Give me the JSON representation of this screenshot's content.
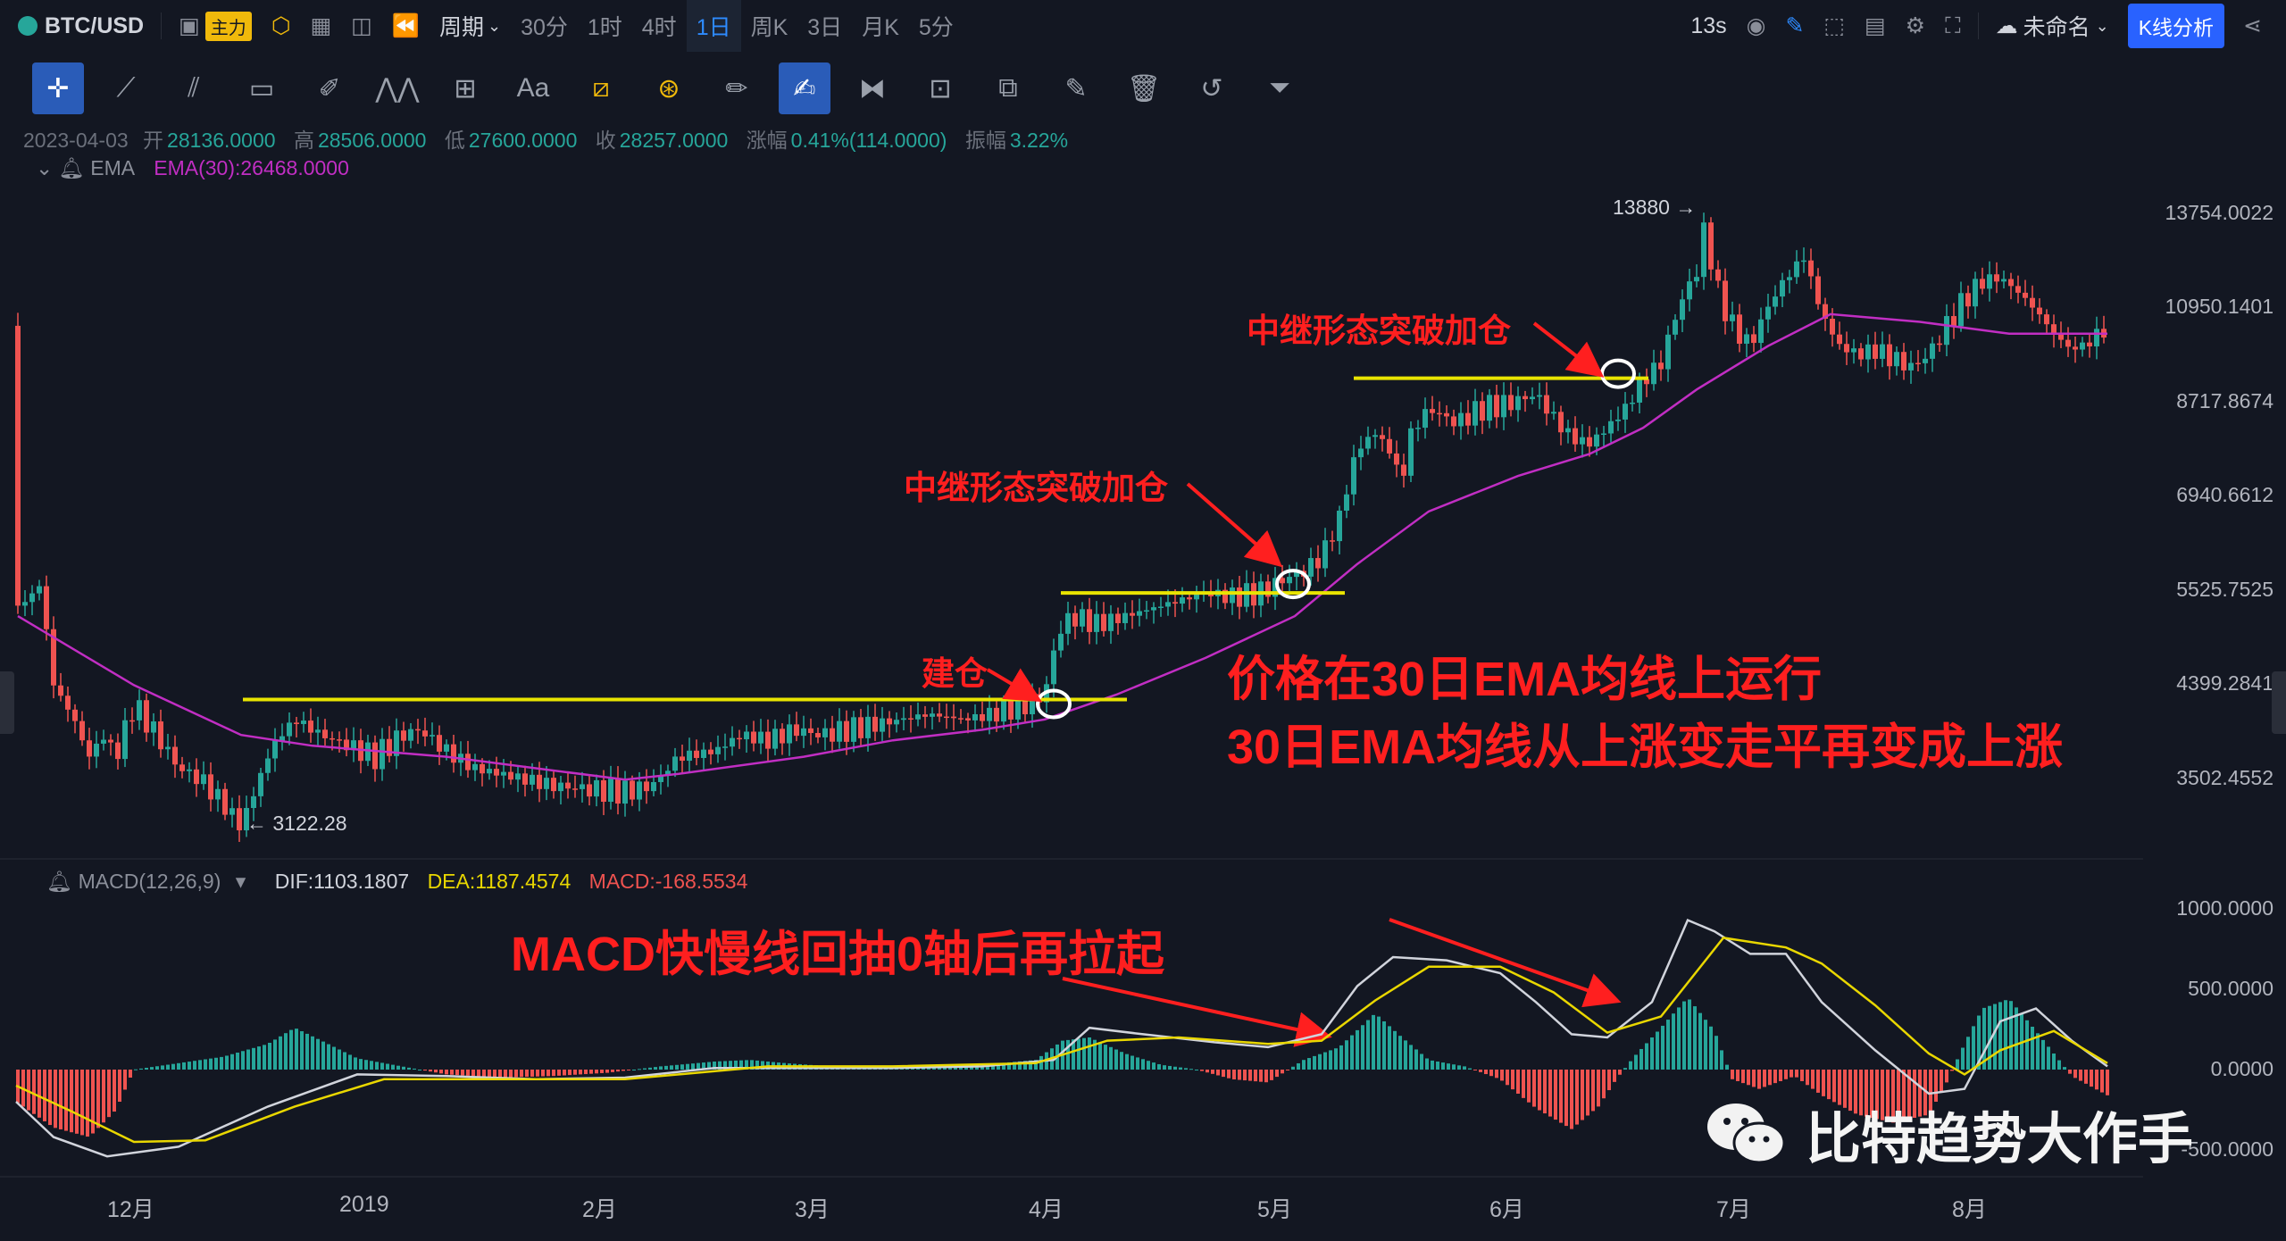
{
  "topbar": {
    "symbol": "BTC/USD",
    "main_badge": "主力",
    "period_label": "周期",
    "intervals": [
      "30分",
      "1时",
      "4时",
      "1日",
      "周K",
      "3日",
      "月K",
      "5分"
    ],
    "active_interval": "1日",
    "countdown": "13s",
    "layout_name": "未命名",
    "analysis_button": "K线分析"
  },
  "toolbar": {
    "text_tool": "Aa"
  },
  "legend": {
    "date": "2023-04-03",
    "open_label": "开",
    "open": "28136.0000",
    "high_label": "高",
    "high": "28506.0000",
    "low_label": "低",
    "low": "27600.0000",
    "close_label": "收",
    "close": "28257.0000",
    "change_label": "涨幅",
    "change": "0.41%(114.0000)",
    "amp_label": "振幅",
    "amp": "3.22%"
  },
  "ema_indicator": {
    "name": "EMA",
    "value_text": "EMA(30):26468.0000"
  },
  "macd_indicator": {
    "name": "MACD(12,26,9)",
    "dif": "DIF:1103.1807",
    "dea": "DEA:1187.4574",
    "macd": "MACD:-168.5534"
  },
  "price_axis": [
    "13754.0022",
    "10950.1401",
    "8717.8674",
    "6940.6612",
    "5525.7525",
    "4399.2841",
    "3502.4552"
  ],
  "macd_axis": [
    "1000.0000",
    "500.0000",
    "0.0000",
    "-500.0000"
  ],
  "time_axis": [
    "12月",
    "2019",
    "2月",
    "3月",
    "4月",
    "5月",
    "6月",
    "7月",
    "8月"
  ],
  "price_markers": {
    "high": "13880",
    "low": "3122.28"
  },
  "annotations": {
    "build": "建仓",
    "add1": "中继形态突破加仓",
    "add2": "中继形态突破加仓",
    "ema_line1": "价格在30日EMA均线上运行",
    "ema_line2": "30日EMA均线从上涨变走平再变成上涨",
    "macd": "MACD快慢线回抽0轴后再拉起"
  },
  "watermark": "比特趋势大作手",
  "colors": {
    "up": "#26a69a",
    "down": "#ef5350",
    "ema": "#c12ec3",
    "dea": "#e9d700",
    "dif": "#d1d4dc",
    "level_line": "#e9e400",
    "annotation": "#ff1f1f",
    "accent": "#2962ff"
  },
  "chart_data": {
    "type": "candlestick",
    "title": "BTC/USD 1日",
    "y_scale": "log",
    "price_range": [
      3122.28,
      13880
    ],
    "ema_period": 30,
    "key_points": [
      {
        "month": "12月",
        "close": 3500
      },
      {
        "month": "2019",
        "close": 3900
      },
      {
        "month": "2月",
        "close": 3600
      },
      {
        "month": "3月",
        "close": 3850
      },
      {
        "month": "4月",
        "close": 4100
      },
      {
        "month": "5月",
        "close": 5400
      },
      {
        "month": "6月",
        "close": 8700
      },
      {
        "month": "7月",
        "close": 11000
      },
      {
        "month": "8月",
        "close": 10500
      }
    ],
    "levels": [
      4250,
      5500,
      9250
    ],
    "macd_range": [
      -500,
      1000
    ]
  }
}
